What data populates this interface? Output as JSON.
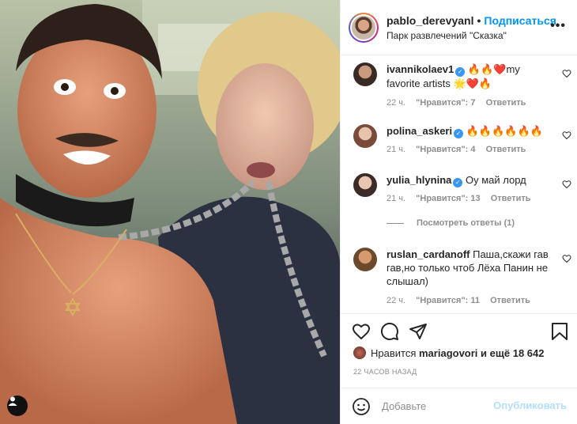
{
  "header": {
    "username": "pablo_derevyanl",
    "separator": "•",
    "follow_label": "Подписаться",
    "location": "Парк развлечений \"Сказка\"",
    "more_label": "•••"
  },
  "comments": [
    {
      "username": "ivannikolaev1",
      "verified": true,
      "text": "🔥🔥❤️my favorite artists 🌟❤️🔥",
      "age": "22 ч.",
      "likes": "\"Нравится\": 7",
      "reply": "Ответить"
    },
    {
      "username": "polina_askeri",
      "verified": true,
      "text": "🔥🔥🔥🔥🔥🔥",
      "age": "21 ч.",
      "likes": "\"Нравится\": 4",
      "reply": "Ответить"
    },
    {
      "username": "yulia_hlynina",
      "verified": true,
      "text": "Оу май лорд",
      "age": "21 ч.",
      "likes": "\"Нравится\": 13",
      "reply": "Ответить"
    },
    {
      "username": "ruslan_cardanoff",
      "verified": false,
      "text": "Паша,скажи гав гав,но только чтоб Лёха Панин не слышал)",
      "age": "22 ч.",
      "likes": "\"Нравится\": 11",
      "reply": "Ответить"
    }
  ],
  "view_replies": "Посмотреть ответы (1)",
  "likes": {
    "prefix": "Нравится",
    "user": "mariagovori",
    "suffix": "и ещё",
    "count": "18 642"
  },
  "timestamp": "22 ЧАСОВ НАЗАД",
  "add_comment": {
    "placeholder": "Добавьте",
    "post_label": "Опубликовать"
  },
  "icons": {
    "like": "heart-icon",
    "comment": "comment-icon",
    "share": "paper-plane-icon",
    "save": "bookmark-icon",
    "emoji": "smiley-icon",
    "user_tag": "person-icon"
  },
  "colors": {
    "accent": "#0095f6",
    "verified": "#3897f0",
    "muted": "#8e8e8e",
    "post_disabled": "#b2dffc"
  }
}
